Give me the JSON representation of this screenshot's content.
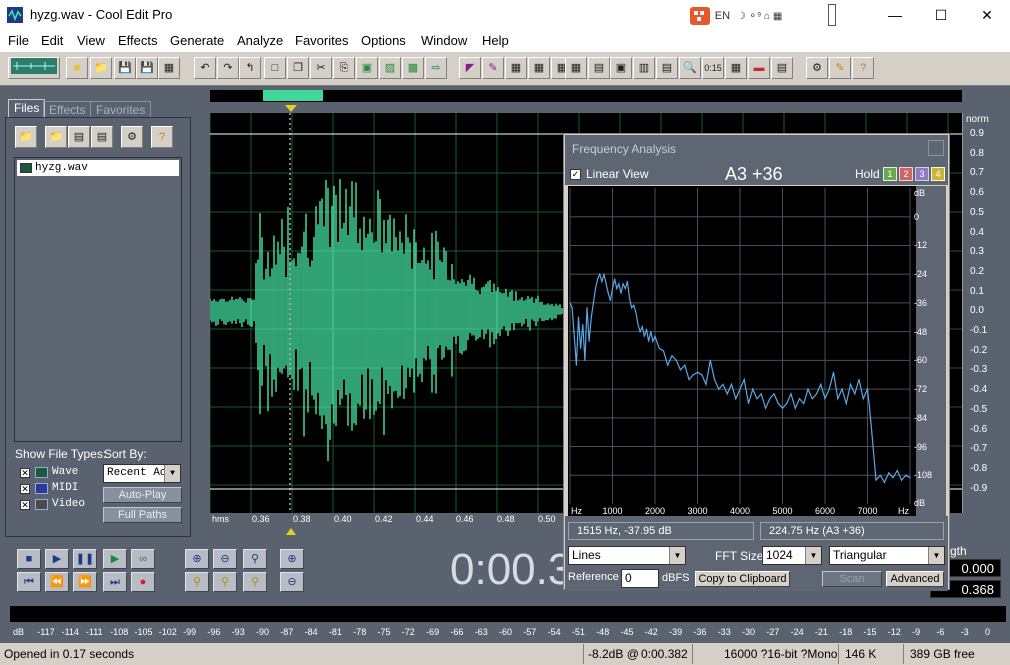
{
  "window": {
    "title": "hyzg.wav - Cool Edit Pro"
  },
  "tray": {
    "label": "EN"
  },
  "menu": [
    {
      "label": "File"
    },
    {
      "label": "Edit"
    },
    {
      "label": "View"
    },
    {
      "label": "Effects"
    },
    {
      "label": "Generate"
    },
    {
      "label": "Analyze"
    },
    {
      "label": "Favorites"
    },
    {
      "label": "Options"
    },
    {
      "label": "Window"
    },
    {
      "label": "Help"
    }
  ],
  "toolbar": {
    "time_icon_label": "0:15"
  },
  "leftpane": {
    "tabs": [
      {
        "label": "Files"
      },
      {
        "label": "Effects"
      },
      {
        "label": "Favorites"
      }
    ],
    "files": [
      {
        "name": "hyzg.wav"
      }
    ],
    "show_file_types_label": "Show File Types:",
    "sort_by_label": "Sort By:",
    "sort_by_value": "Recent Ac",
    "types": [
      {
        "label": "Wave",
        "checked": true
      },
      {
        "label": "MIDI",
        "checked": true
      },
      {
        "label": "Video",
        "checked": true
      }
    ],
    "autoplay_label": "Auto-Play",
    "fullpaths_label": "Full Paths"
  },
  "ruler": {
    "labels": [
      "hms",
      "0.36",
      "0.38",
      "0.40",
      "0.42",
      "0.44",
      "0.46",
      "0.48",
      "0.50"
    ]
  },
  "yaxis": {
    "top_label": "norm",
    "labels": [
      "0.9",
      "0.8",
      "0.7",
      "0.6",
      "0.5",
      "0.4",
      "0.3",
      "0.2",
      "0.1",
      "0.0",
      "-0.1",
      "-0.2",
      "-0.3",
      "-0.4",
      "-0.5",
      "-0.6",
      "-0.7",
      "-0.8",
      "-0.9"
    ]
  },
  "freq_analysis": {
    "title": "Frequency Analysis",
    "linear_view_label": "Linear View",
    "note": "A3 +36",
    "hold_label": "Hold",
    "hold_buttons": [
      "1",
      "2",
      "3",
      "4"
    ],
    "hold_colors": [
      "#6aa84f",
      "#cc6666",
      "#8e7cc3",
      "#c9b43a"
    ],
    "x_labels": [
      "Hz",
      "1000",
      "2000",
      "3000",
      "4000",
      "5000",
      "6000",
      "7000",
      "Hz"
    ],
    "db_labels": [
      "dB",
      "0",
      "-12",
      "-24",
      "-36",
      "-48",
      "-60",
      "-72",
      "-84",
      "-96",
      "-108",
      "dB"
    ],
    "cursor_readout": "1515 Hz, -37.95 dB",
    "peak_readout": "224.75 Hz (A3 +36)",
    "display_mode": "Lines",
    "fft_label": "FFT Size",
    "fft_size": "1024",
    "window_fn": "Triangular",
    "reference_label": "Reference",
    "reference_value": "0",
    "dbfs_label": "dBFS",
    "copy_label": "Copy to Clipboard",
    "scan_label": "Scan",
    "advanced_label": "Advanced",
    "line_color": "#5aa8e6",
    "chart_data": {
      "type": "line",
      "xlabel": "Hz",
      "ylabel": "dB",
      "xlim": [
        0,
        8000
      ],
      "ylim": [
        -120,
        12
      ],
      "x": [
        0,
        50,
        100,
        150,
        200,
        250,
        300,
        350,
        400,
        450,
        500,
        550,
        600,
        650,
        700,
        750,
        800,
        850,
        900,
        950,
        1000,
        1050,
        1100,
        1150,
        1200,
        1250,
        1300,
        1350,
        1400,
        1450,
        1500,
        1550,
        1600,
        1650,
        1700,
        1750,
        1800,
        1850,
        1900,
        1950,
        2000,
        2100,
        2200,
        2300,
        2400,
        2500,
        2600,
        2700,
        2800,
        2900,
        3000,
        3100,
        3200,
        3300,
        3400,
        3500,
        3600,
        3700,
        3800,
        3900,
        4000,
        4100,
        4200,
        4300,
        4400,
        4500,
        4600,
        4700,
        4800,
        4900,
        5000,
        5100,
        5200,
        5300,
        5400,
        5500,
        5600,
        5700,
        5800,
        5900,
        6000,
        6100,
        6200,
        6300,
        6400,
        6500,
        6600,
        6700,
        6800,
        6900,
        7000,
        7050,
        7100,
        7150,
        7200,
        7300,
        7400,
        7500,
        7600,
        7700,
        7800,
        7900,
        8000
      ],
      "y": [
        -36,
        -38,
        -50,
        -62,
        -42,
        -55,
        -45,
        -60,
        -38,
        -52,
        -42,
        -36,
        -30,
        -26,
        -24,
        -27,
        -24,
        -28,
        -32,
        -35,
        -30,
        -26,
        -30,
        -28,
        -32,
        -28,
        -30,
        -27,
        -34,
        -38,
        -37,
        -40,
        -45,
        -48,
        -46,
        -50,
        -47,
        -52,
        -48,
        -52,
        -50,
        -55,
        -56,
        -62,
        -58,
        -60,
        -64,
        -62,
        -68,
        -66,
        -65,
        -66,
        -70,
        -60,
        -68,
        -72,
        -70,
        -74,
        -70,
        -76,
        -72,
        -68,
        -78,
        -72,
        -76,
        -74,
        -80,
        -76,
        -74,
        -78,
        -80,
        -78,
        -74,
        -80,
        -76,
        -78,
        -72,
        -76,
        -74,
        -70,
        -76,
        -72,
        -65,
        -76,
        -72,
        -78,
        -70,
        -74,
        -68,
        -76,
        -72,
        -80,
        -90,
        -100,
        -110,
        -108,
        -111,
        -107,
        -109,
        -106,
        -110,
        -108,
        -109
      ]
    }
  },
  "transport": {
    "time": "0:00.3",
    "length_label": "gth",
    "sel_begin": "0.000",
    "sel_end": "0.368"
  },
  "meter": {
    "labels": [
      "dB",
      "-117",
      "-114",
      "-111",
      "-108",
      "-105",
      "-102",
      "-99",
      "-96",
      "-93",
      "-90",
      "-87",
      "-84",
      "-81",
      "-78",
      "-75",
      "-72",
      "-69",
      "-66",
      "-63",
      "-60",
      "-57",
      "-54",
      "-51",
      "-48",
      "-45",
      "-42",
      "-39",
      "-36",
      "-33",
      "-30",
      "-27",
      "-24",
      "-21",
      "-18",
      "-15",
      "-12",
      "-9",
      "-6",
      "-3",
      "0"
    ]
  },
  "status": {
    "message": "Opened in 0.17 seconds",
    "level": "-8.2dB @",
    "position": "0:00.382",
    "format": "16000 ?16-bit ?Mono",
    "size": "146 K",
    "free": "389 GB free"
  }
}
